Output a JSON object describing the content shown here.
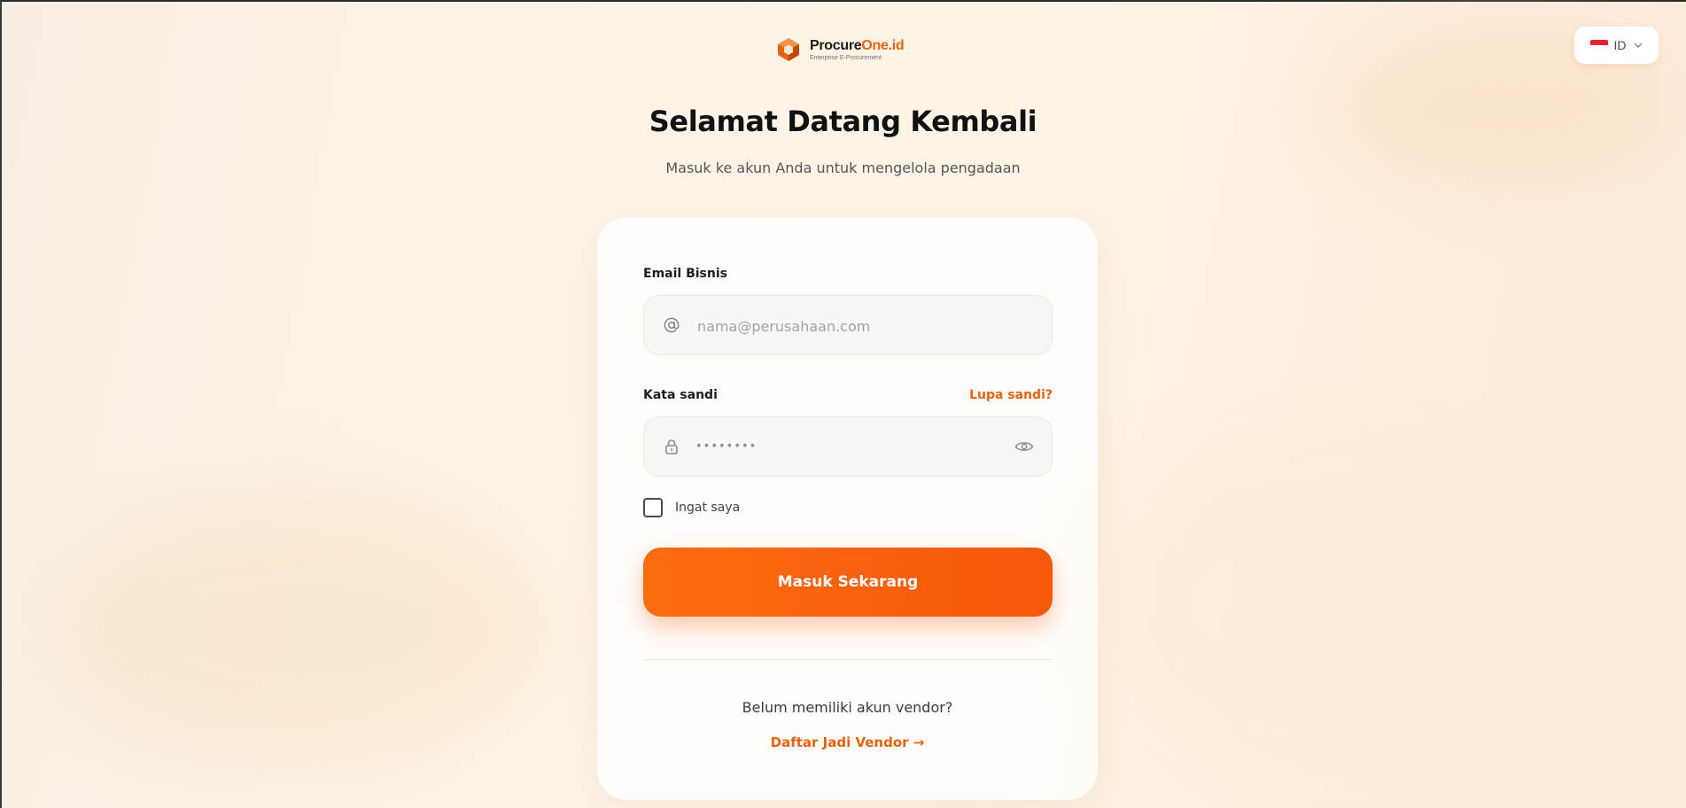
{
  "brand": {
    "name_prefix": "Procure",
    "name_accent": "One.id",
    "tagline": "Enterprise E-Procurement",
    "accent_color": "#e8620f",
    "logo_icon": "hexagon-logo-icon"
  },
  "language": {
    "code": "ID",
    "flag": "indonesia-flag-icon",
    "chevron": "chevron-down-icon"
  },
  "header": {
    "title": "Selamat Datang Kembali",
    "subtitle": "Masuk ke akun Anda untuk mengelola pengadaan"
  },
  "form": {
    "email_label": "Email Bisnis",
    "email_placeholder": "nama@perusahaan.com",
    "email_icon": "at-sign-icon",
    "password_label": "Kata sandi",
    "forgot_label": "Lupa sandi?",
    "password_mask": "••••••••",
    "password_icon": "lock-icon",
    "toggle_icon": "eye-icon",
    "remember_label": "Ingat saya",
    "submit_label": "Masuk Sekarang",
    "button_color": "#fb6c10"
  },
  "footer": {
    "prompt": "Belum memiliki akun vendor?",
    "register_label": "Daftar Jadi Vendor →"
  }
}
